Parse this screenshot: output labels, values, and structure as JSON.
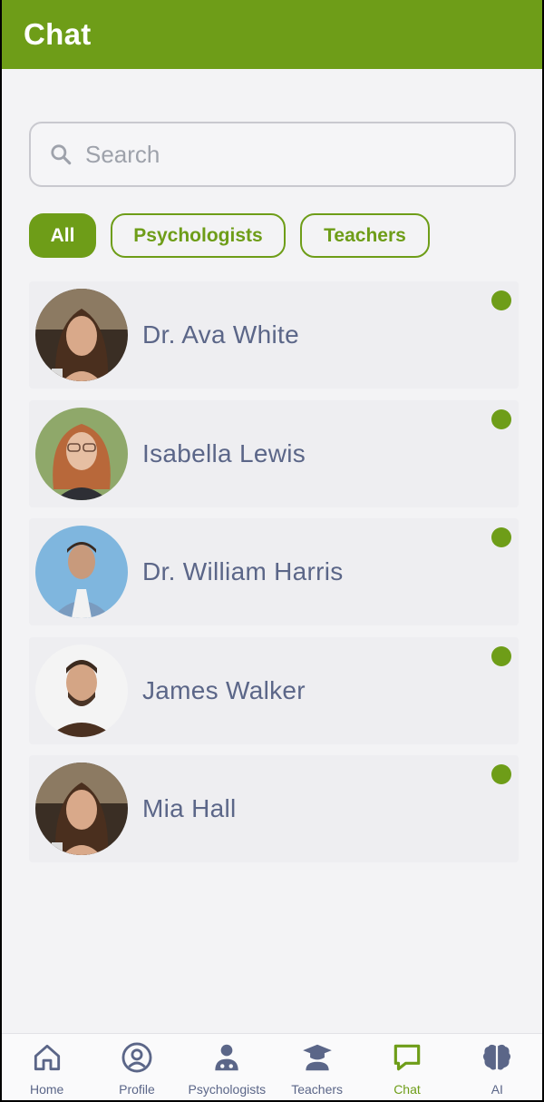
{
  "header": {
    "title": "Chat"
  },
  "search": {
    "placeholder": "Search",
    "value": ""
  },
  "filters": [
    {
      "label": "All",
      "selected": true
    },
    {
      "label": "Psychologists",
      "selected": false
    },
    {
      "label": "Teachers",
      "selected": false
    }
  ],
  "contacts": [
    {
      "name": "Dr. Ava White",
      "online": true
    },
    {
      "name": "Isabella Lewis",
      "online": true
    },
    {
      "name": "Dr. William Harris",
      "online": true
    },
    {
      "name": "James Walker",
      "online": true
    },
    {
      "name": "Mia Hall",
      "online": true
    }
  ],
  "nav": [
    {
      "label": "Home",
      "icon": "home-icon"
    },
    {
      "label": "Profile",
      "icon": "profile-icon"
    },
    {
      "label": "Psychologists",
      "icon": "doctor-icon"
    },
    {
      "label": "Teachers",
      "icon": "graduation-cap-icon"
    },
    {
      "label": "Chat",
      "icon": "chat-bubble-icon",
      "active": true
    },
    {
      "label": "AI",
      "icon": "brain-icon"
    }
  ],
  "colors": {
    "accent": "#6e9d18",
    "text": "#5b6688",
    "background": "#f3f3f5"
  }
}
